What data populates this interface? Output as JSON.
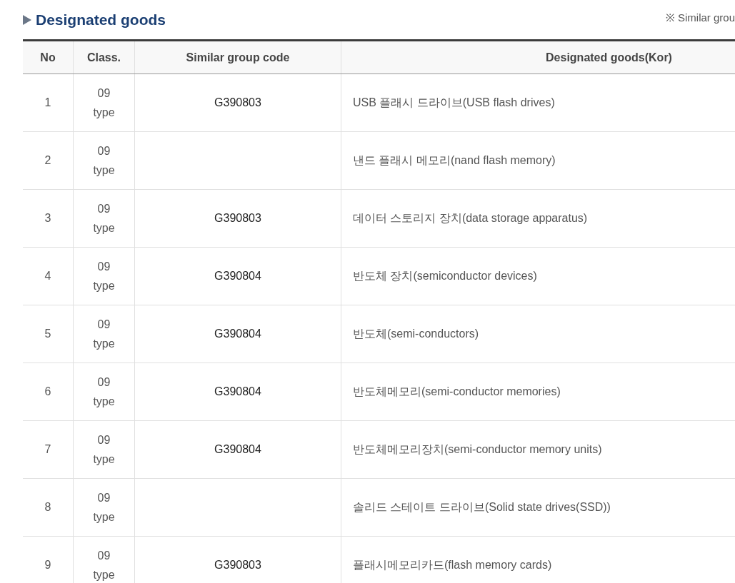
{
  "section_title": "Designated goods",
  "note": "※ Similar grou",
  "table": {
    "columns": [
      "No",
      "Class.",
      "Similar group code",
      "Designated goods(Kor)"
    ],
    "rows": [
      {
        "no": "1",
        "class": [
          "09",
          "type"
        ],
        "code": "G390803",
        "goods": "USB 플래시 드라이브(USB flash drives)"
      },
      {
        "no": "2",
        "class": [
          "09",
          "type"
        ],
        "goods": "낸드 플래시 메모리(nand flash memory)"
      },
      {
        "no": "3",
        "class": [
          "09",
          "type"
        ],
        "code": "G390803",
        "goods": "데이터 스토리지 장치(data storage apparatus)"
      },
      {
        "no": "4",
        "class": [
          "09",
          "type"
        ],
        "code": "G390804",
        "goods": "반도체 장치(semiconductor devices)"
      },
      {
        "no": "5",
        "class": [
          "09",
          "type"
        ],
        "code": "G390804",
        "goods": "반도체(semi-conductors)"
      },
      {
        "no": "6",
        "class": [
          "09",
          "type"
        ],
        "code": "G390804",
        "goods": "반도체메모리(semi-conductor memories)"
      },
      {
        "no": "7",
        "class": [
          "09",
          "type"
        ],
        "code": "G390804",
        "goods": "반도체메모리장치(semi-conductor memory units)"
      },
      {
        "no": "8",
        "class": [
          "09",
          "type"
        ],
        "goods": "솔리드 스테이트 드라이브(Solid state drives(SSD))"
      },
      {
        "no": "9",
        "class": [
          "09",
          "type"
        ],
        "code": "G390803",
        "goods": "플래시메모리카드(flash memory cards)"
      }
    ]
  }
}
